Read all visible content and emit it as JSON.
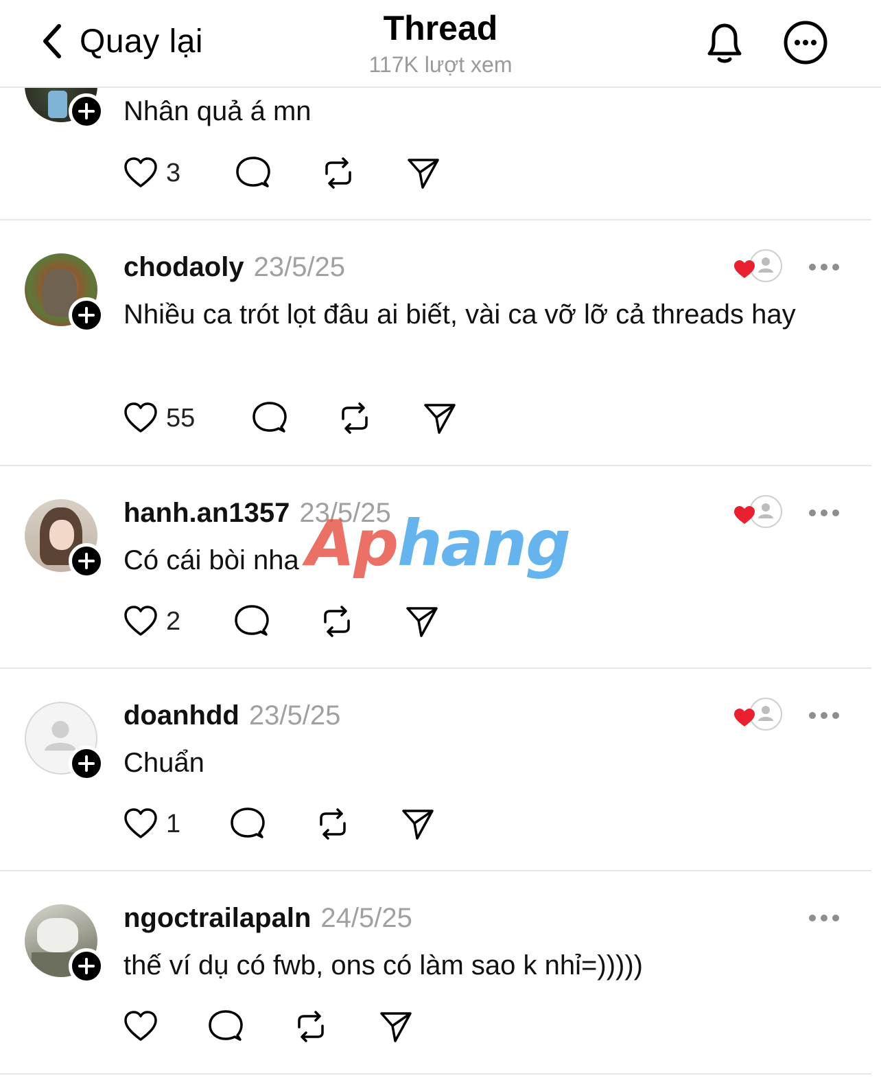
{
  "header": {
    "back_label": "Quay lại",
    "title": "Thread",
    "subtitle": "117K lượt xem"
  },
  "icons": {
    "back": "chevron-left-icon",
    "bell": "bell-icon",
    "more": "more-circle-icon",
    "like": "heart-outline-icon",
    "comment": "comment-icon",
    "repost": "repost-icon",
    "share": "send-icon"
  },
  "colors": {
    "text": "#111111",
    "muted": "#a0a0a0",
    "heart_red": "#e8202f",
    "divider": "#e6e6e6"
  },
  "posts": [
    {
      "username": "",
      "date": "",
      "text": "Nhân quả á mn",
      "likes": "3"
    },
    {
      "username": "chodaoly",
      "date": "23/5/25",
      "text": "Nhiều ca trót lọt đâu ai biết, vài ca vỡ lỡ cả threads hay",
      "likes": "55",
      "liked_by_author": true
    },
    {
      "username": "hanh.an1357",
      "date": "23/5/25",
      "text": "Có cái bòi nha",
      "likes": "2",
      "liked_by_author": true
    },
    {
      "username": "doanhdd",
      "date": "23/5/25",
      "text": "Chuẩn",
      "likes": "1",
      "liked_by_author": true
    },
    {
      "username": "ngoctrailapaln",
      "date": "24/5/25",
      "text": "thế ví dụ có fwb, ons có làm sao k nhỉ=)))))",
      "likes": ""
    }
  ],
  "watermark": {
    "part1": "Ap",
    "part2": "hang"
  }
}
